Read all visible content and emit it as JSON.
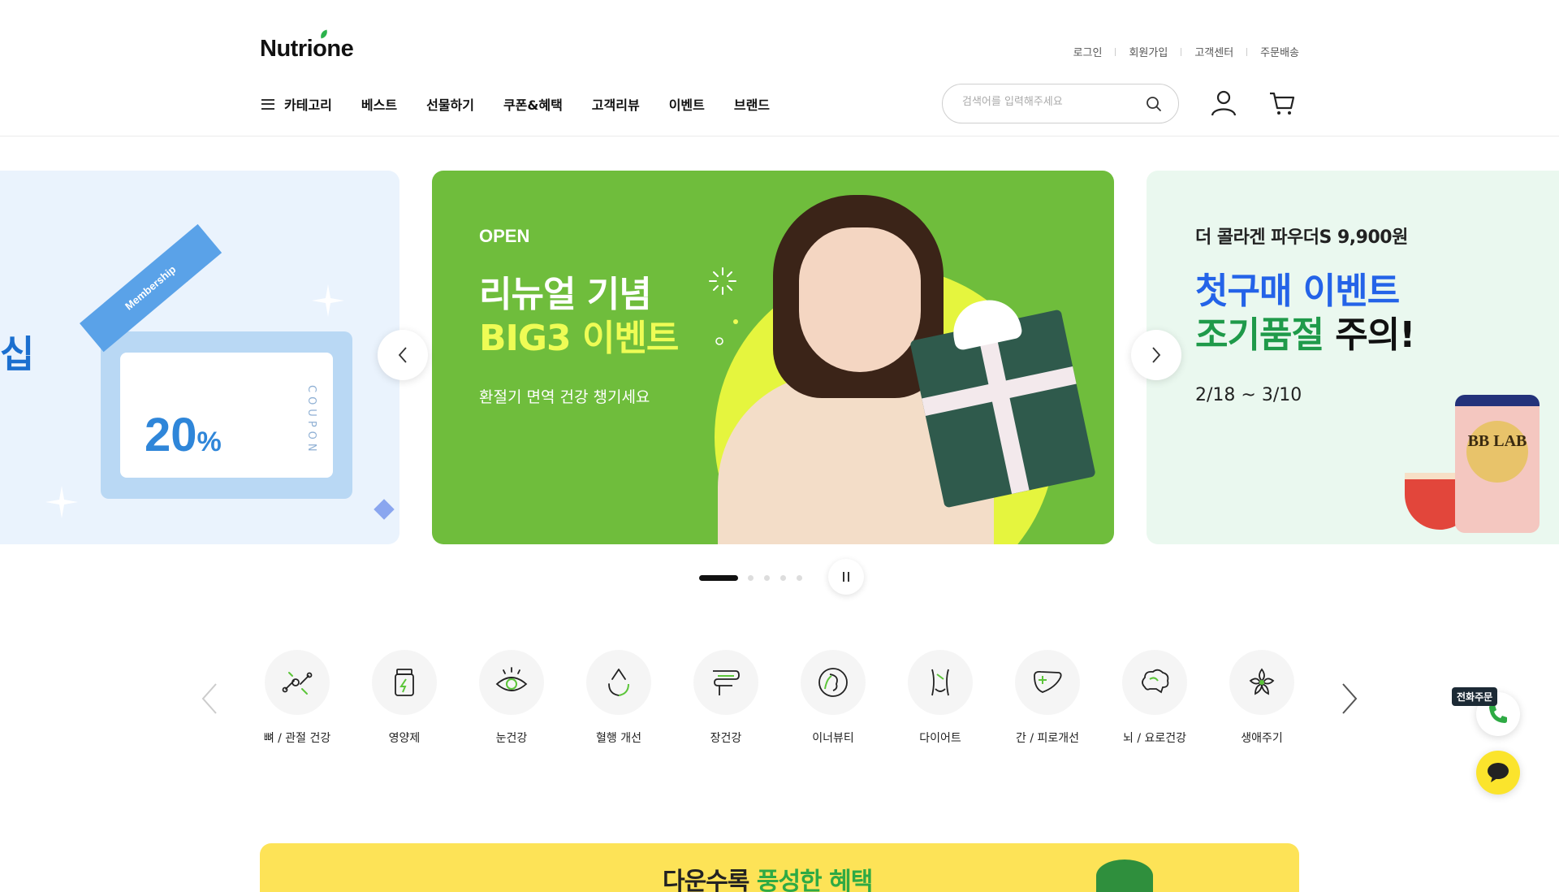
{
  "brand": {
    "logo_text": "Nutrione"
  },
  "util_links": {
    "login": "로그인",
    "signup": "회원가입",
    "support": "고객센터",
    "order": "주문배송"
  },
  "gnb": {
    "category": "카테고리",
    "items": [
      "베스트",
      "선물하기",
      "쿠폰&혜택",
      "고객리뷰",
      "이벤트",
      "브랜드"
    ]
  },
  "search": {
    "placeholder": "검색어를 입력해주세요",
    "value": ""
  },
  "banner": {
    "left": {
      "edge_text": "십",
      "ribbon": "Membership",
      "coupon_value": "20",
      "coupon_unit": "%",
      "coupon_word": "COUPON"
    },
    "main": {
      "tag": "OPEN",
      "title_line1": "리뉴얼 기념",
      "title_line2": "BIG3 이벤트",
      "subtitle": "환절기 면역 건강 챙기세요"
    },
    "right": {
      "line1": "더 콜라겐 파우더S 9,900원",
      "line2": "첫구매 이벤트",
      "line3_green": "조기품절",
      "line3_dark": " 주의!",
      "date": "2/18 ~ 3/10",
      "product_label": "BB LAB"
    },
    "pagination": {
      "active_index": 0,
      "total": 5
    }
  },
  "categories": [
    {
      "label": "뼈 / 관절 건강",
      "icon": "bone-joint-icon"
    },
    {
      "label": "영양제",
      "icon": "supplement-bottle-icon"
    },
    {
      "label": "눈건강",
      "icon": "eye-icon"
    },
    {
      "label": "혈행 개선",
      "icon": "circulation-icon"
    },
    {
      "label": "장건강",
      "icon": "intestine-icon"
    },
    {
      "label": "이너뷰티",
      "icon": "face-beauty-icon"
    },
    {
      "label": "다이어트",
      "icon": "waist-icon"
    },
    {
      "label": "간 / 피로개선",
      "icon": "liver-icon"
    },
    {
      "label": "뇌 / 요로건강",
      "icon": "brain-icon"
    },
    {
      "label": "생애주기",
      "icon": "lifecycle-flower-icon"
    }
  ],
  "floating": {
    "phone_tag": "전화주문"
  },
  "bottom_banner": {
    "left_text": "",
    "main_text": "다운수록 ",
    "main_highlight": "풍성한 혜택"
  },
  "colors": {
    "accent_green": "#6fbd3c",
    "accent_blue": "#2463e8",
    "kakao_yellow": "#fbe42c",
    "banner_yellow": "#fde357"
  }
}
